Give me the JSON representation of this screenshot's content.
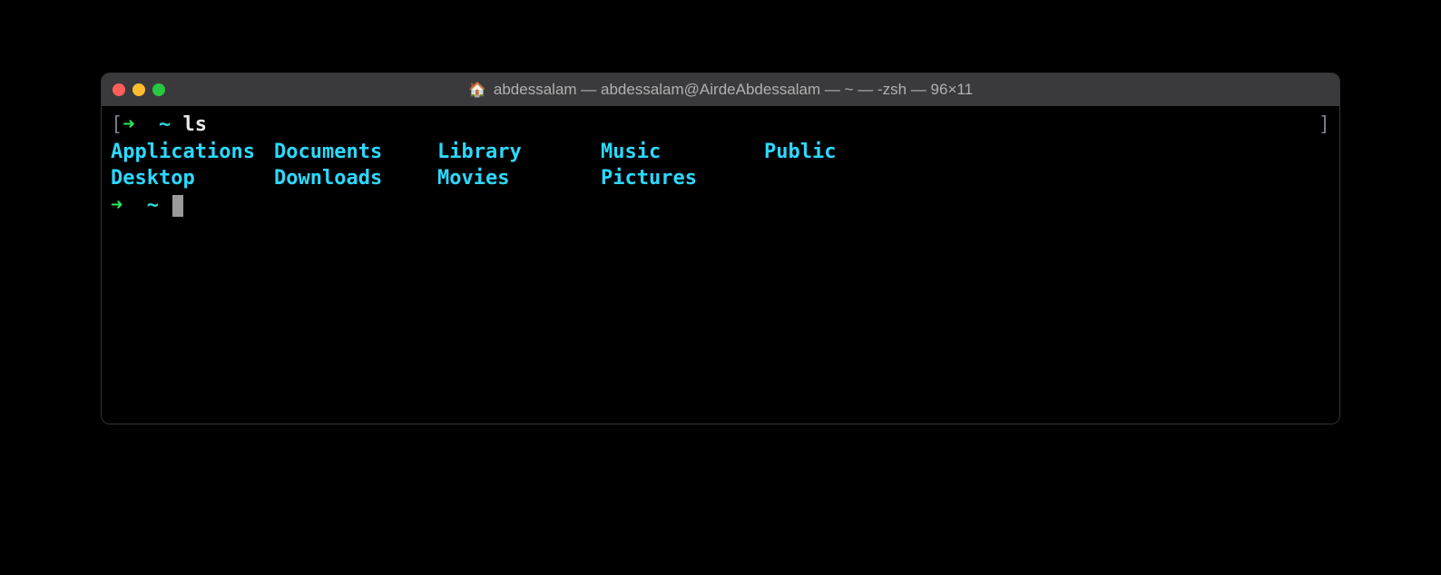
{
  "window": {
    "title_icon": "🏠",
    "title": "abdessalam — abdessalam@AirdeAbdessalam — ~ — -zsh — 96×11"
  },
  "prompt": {
    "open_bracket": "[",
    "close_bracket": "]",
    "arrow": "➜",
    "path": "~",
    "command": "ls"
  },
  "ls_output": {
    "columns": [
      [
        "Applications",
        "Desktop"
      ],
      [
        "Documents",
        "Downloads"
      ],
      [
        "Library",
        "Movies"
      ],
      [
        "Music",
        "Pictures"
      ],
      [
        "Public"
      ]
    ]
  },
  "colors": {
    "arrow": "#29e85a",
    "path": "#2cd9d9",
    "dir": "#2cd9ff",
    "bracket": "#7a7a8c",
    "titlebar": "#3a3a3c",
    "traffic_close": "#ff5f57",
    "traffic_min": "#febc2e",
    "traffic_max": "#28c840"
  }
}
